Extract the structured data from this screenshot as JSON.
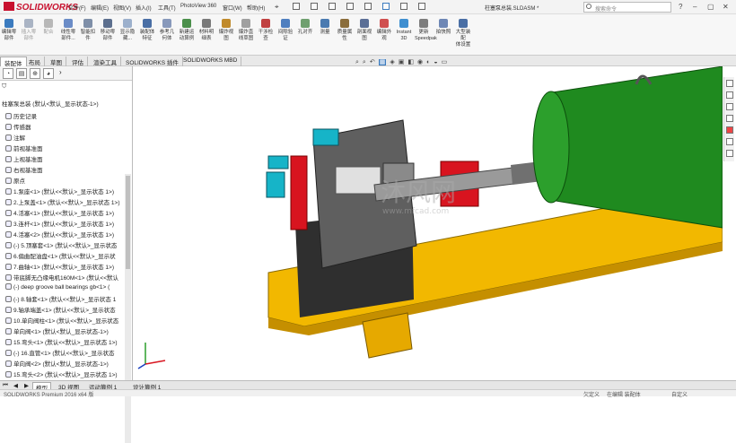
{
  "app": {
    "logo_text": "SOLIDWORKS",
    "doc_title": "柱塞泵总装.SLDASM *",
    "brand_color": "#c8102e"
  },
  "menu": [
    "文件(F)",
    "编辑(E)",
    "视图(V)",
    "插入(I)",
    "工具(T)",
    "PhotoView 360",
    "窗口(W)",
    "帮助(H)"
  ],
  "search": {
    "placeholder": "搜索命令"
  },
  "commands": [
    "编辑零件",
    "插入零部件",
    "配合",
    "线性零部件阵列",
    "智能扣件",
    "移动零部件",
    "显示隐藏的零部件",
    "装配体特征",
    "参考几何体",
    "新建运动算例",
    "材料明细表",
    "爆炸视图",
    "爆炸直线草图",
    "干涉检查",
    "间隙验证",
    "孔对齐",
    "测量",
    "质量属性",
    "剖面视图",
    "编辑外观",
    "Instant3D",
    "更新Speedpak子装配体",
    "拍快照",
    "大型装配体设置"
  ],
  "ribbon": {
    "c0": "编辑零\n部件",
    "c1": "插入零\n部件",
    "c2": "配合",
    "c3": "线性零\n部件...",
    "c4": "智能扣\n件",
    "c5": "移动零\n部件",
    "c6": "显示隐\n藏...",
    "c7": "装配体\n特征",
    "c8": "参考几\n何体",
    "c9": "新建运\n动算例",
    "c10": "材料明\n细表",
    "c11": "爆炸视\n图",
    "c12": "爆炸直\n线草图",
    "c13": "干涉检\n查",
    "c14": "间隙验\n证",
    "c15": "孔对齐",
    "c16": "测量",
    "c17": "质量属\n性",
    "c18": "剖面视\n图",
    "c19": "编辑外\n观",
    "c20": "Instant\n3D",
    "c21": "更新\nSpeedpak",
    "c22": "拍快照",
    "c23": "大型装配\n体设置"
  },
  "tabs": [
    "装配体",
    "布局",
    "草图",
    "评估",
    "渲染工具",
    "SOLIDWORKS 插件",
    "SOLIDWORKS MBD"
  ],
  "feature_tree": {
    "root": "柱塞泵总装 (默认<默认_显示状态-1>)",
    "items": [
      "历史记录",
      "传感器",
      "注解",
      "前视基准面",
      "上视基准面",
      "右视基准面",
      "原点",
      "1.泵座<1> (默认<<默认>_显示状态 1>)",
      "2.上泵盖<1> (默认<<默认>_显示状态 1>)",
      "4.活塞<1> (默认<<默认>_显示状态 1>)",
      "3.连杆<1> (默认<<默认>_显示状态 1>)",
      "4.活塞<2> (默认<<默认>_显示状态 1>)",
      "(-) 5.顶塞套<1> (默认<<默认>_显示状态",
      "6.偏曲配油盘<1> (默认<<默认>_显示状",
      "7.曲轴<1> (默认<<默认>_显示状态 1>)",
      "带底脚无凸缘电机160M<1> (默认<<默认",
      "(-) deep groove ball bearings gb<1> (",
      "(-) 8.轴套<1> (默认<<默认>_显示状态 1",
      "9.轴承端盖<1> (默认<<默认>_显示状态",
      "10.单向阀柱<1> (默认<<默认>_显示状态",
      "单向阀<1> (默认<默认_显示状态-1>)",
      "15.弯头<1> (默认<<默认>_显示状态 1>)",
      "(-) 16.直管<1> (默认<<默认>_显示状态",
      "单向阀<2> (默认<默认_显示状态-1>)",
      "15.弯头<2> (默认<<默认>_显示状态 1>)"
    ]
  },
  "bottom_tabs": [
    "模型",
    "3D 视图",
    "运动算例 1",
    "设计算例 1"
  ],
  "status": {
    "left": "SOLIDWORKS Premium 2016 x64 版",
    "mid1": "欠定义",
    "mid2": "在编辑 装配体",
    "right": "自定义"
  },
  "watermark": "沐风网",
  "watermark_url": "www.mfcad.com",
  "colors": {
    "green": "#1f8a1f",
    "yellow": "#f2b800",
    "red": "#d8141f",
    "cyan": "#16b4c8",
    "grey": "#5a5a5a"
  }
}
